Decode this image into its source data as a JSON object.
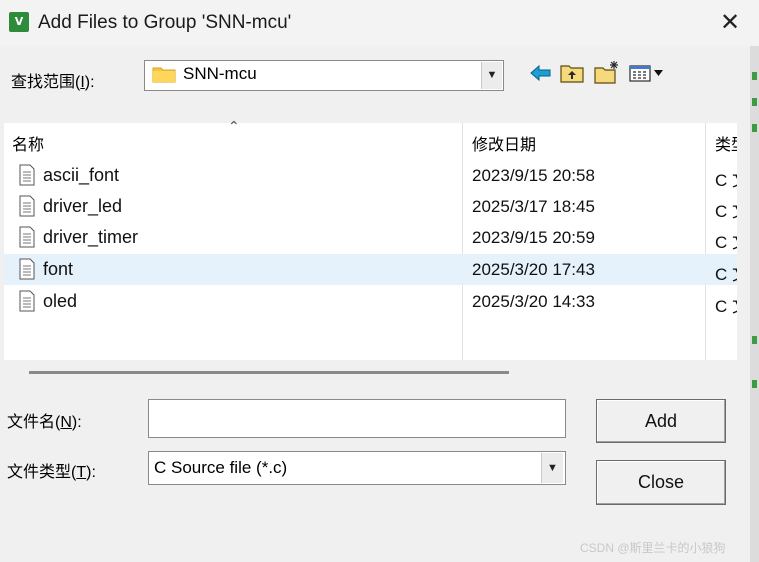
{
  "window": {
    "title": "Add Files to Group 'SNN-mcu'",
    "close_glyph": "✕",
    "icon_text": "V"
  },
  "lookin": {
    "label_prefix": "查找范围(",
    "label_key": "I",
    "label_suffix": "):",
    "value": "SNN-mcu"
  },
  "list": {
    "headers": {
      "name": "名称",
      "date": "修改日期",
      "type": "类型"
    },
    "sort_glyph": "⌃",
    "rows": [
      {
        "name": "ascii_font",
        "date": "2023/9/15 20:58",
        "type": "C 文件",
        "selected": false
      },
      {
        "name": "driver_led",
        "date": "2025/3/17 18:45",
        "type": "C 文件",
        "selected": false
      },
      {
        "name": "driver_timer",
        "date": "2023/9/15 20:59",
        "type": "C 文件",
        "selected": false
      },
      {
        "name": "font",
        "date": "2025/3/20 17:43",
        "type": "C 文件",
        "selected": true
      },
      {
        "name": "oled",
        "date": "2025/3/20 14:33",
        "type": "C 文件",
        "selected": false
      }
    ]
  },
  "filename": {
    "label_prefix": "文件名(",
    "label_key": "N",
    "label_suffix": "):",
    "value": ""
  },
  "filetype": {
    "label_prefix": "文件类型(",
    "label_key": "T",
    "label_suffix": "):",
    "value": "C Source file (*.c)"
  },
  "buttons": {
    "add": "Add",
    "close": "Close"
  },
  "dropdown_glyph": "▼",
  "watermark": "CSDN @斯里兰卡的小狼狗",
  "icons": {
    "back": "back-arrow-icon",
    "up": "up-folder-icon",
    "new": "new-folder-icon",
    "view": "view-menu-icon"
  },
  "colors": {
    "accent_arrow": "#1a9fd6",
    "folder": "#f5c542",
    "selection": "#e5f1fb"
  }
}
